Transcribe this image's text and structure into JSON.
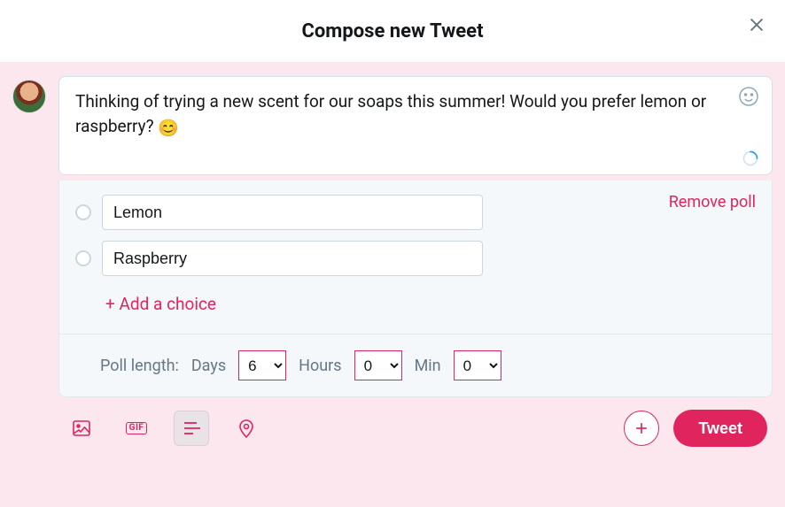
{
  "header": {
    "title": "Compose new Tweet"
  },
  "compose": {
    "text": "Thinking of trying a new scent for our soaps this summer! Would you prefer lemon or raspberry? ",
    "emoji": "😊"
  },
  "poll": {
    "remove_label": "Remove poll",
    "options": [
      {
        "value": "Lemon"
      },
      {
        "value": "Raspberry"
      }
    ],
    "add_choice_label": "+ Add a choice",
    "length_label": "Poll length:",
    "days_label": "Days",
    "days_value": "6",
    "hours_label": "Hours",
    "hours_value": "0",
    "min_label": "Min",
    "min_value": "0"
  },
  "toolbar": {
    "gif_label": "GIF",
    "tweet_label": "Tweet"
  },
  "colors": {
    "accent": "#e0245e"
  }
}
